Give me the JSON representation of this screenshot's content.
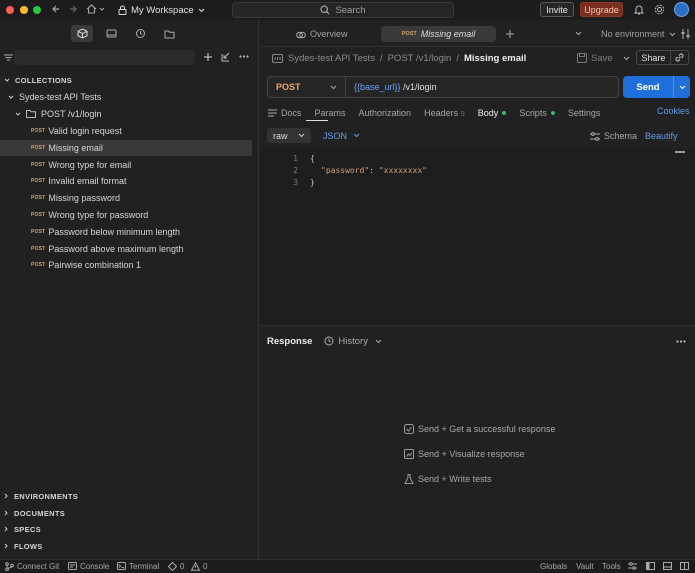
{
  "titlebar": {
    "workspace_label": "My Workspace",
    "search_placeholder": "Search",
    "invite_label": "Invite",
    "upgrade_label": "Upgrade"
  },
  "sidebar": {
    "collections_header": "COLLECTIONS",
    "collection_name": "Sydes-test API Tests",
    "folder_name": "POST /v1/login",
    "requests": [
      {
        "method": "POST",
        "name": "Valid login request"
      },
      {
        "method": "POST",
        "name": "Missing email"
      },
      {
        "method": "POST",
        "name": "Wrong type for email"
      },
      {
        "method": "POST",
        "name": "Invalid email format"
      },
      {
        "method": "POST",
        "name": "Missing password"
      },
      {
        "method": "POST",
        "name": "Wrong type for password"
      },
      {
        "method": "POST",
        "name": "Password below minimum length"
      },
      {
        "method": "POST",
        "name": "Password above maximum length"
      },
      {
        "method": "POST",
        "name": "Pairwise combination 1"
      }
    ],
    "selected_index": 1,
    "bottom_sections": [
      "ENVIRONMENTS",
      "DOCUMENTS",
      "SPECS",
      "FLOWS"
    ]
  },
  "tabs": {
    "overview_label": "Overview",
    "active_method": "POST",
    "active_name": "Missing email",
    "environment_label": "No environment"
  },
  "breadcrumb": {
    "collection": "Sydes-test API Tests",
    "folder": "POST /v1/login",
    "current": "Missing email",
    "save_label": "Save",
    "share_label": "Share"
  },
  "request": {
    "method": "POST",
    "url_variable": "{{base_url}}",
    "url_path": " /v1/login",
    "send_label": "Send",
    "tabs": [
      "Docs",
      "Params",
      "Authorization",
      "Headers",
      "Body",
      "Scripts",
      "Settings"
    ],
    "headers_count": "9",
    "cookies_label": "Cookies",
    "body_mode": "raw",
    "body_format": "JSON",
    "schema_label": "Schema",
    "beautify_label": "Beautify",
    "body_lines": [
      {
        "num": "1",
        "text": "{"
      },
      {
        "num": "2",
        "key": "\"password\"",
        "sep": ": ",
        "value": "\"xxxxxxxx\""
      },
      {
        "num": "3",
        "text": "}"
      }
    ]
  },
  "response": {
    "title": "Response",
    "history_label": "History",
    "hints": [
      "Send + Get a successful response",
      "Send + Visualize response",
      "Send + Write tests"
    ]
  },
  "statusbar": {
    "connect_git": "Connect Git",
    "console": "Console",
    "terminal": "Terminal",
    "errors": "0",
    "warnings": "0",
    "globals": "Globals",
    "vault": "Vault",
    "tools": "Tools"
  },
  "colors": {
    "accent": "#1f6fdb",
    "method_post": "#e6a66c",
    "variable": "#6aa1ff",
    "upgrade": "#7a2e1d",
    "status_dot": "#3fb56e"
  }
}
